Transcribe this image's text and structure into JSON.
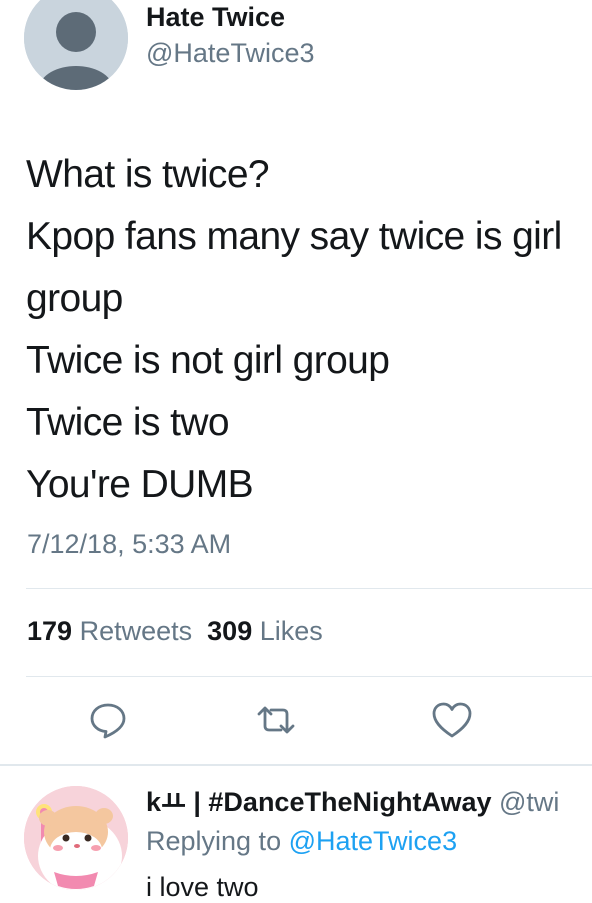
{
  "tweet": {
    "display_name": "Hate Twice",
    "handle": "@HateTwice3",
    "lines": [
      "What is twice?",
      "Kpop fans many say twice is girl",
      "group",
      "Twice is not girl group",
      "Twice is two",
      "You're DUMB"
    ],
    "timestamp": "7/12/18, 5:33 AM",
    "stats": {
      "retweets_count": "179",
      "retweets_label": "Retweets",
      "likes_count": "309",
      "likes_label": "Likes"
    },
    "actions": {
      "reply_icon": "speech-bubble-icon",
      "retweet_icon": "retweet-arrows-icon",
      "like_icon": "heart-icon"
    }
  },
  "reply": {
    "display_name": "kㅛ | #DanceTheNightAway",
    "handle": "@twi",
    "replying_prefix": "Replying to",
    "replying_handle": "@HateTwice3",
    "text": "i love two"
  },
  "colors": {
    "primary_text": "#14171a",
    "secondary_text": "#657786",
    "link": "#1da1f2",
    "divider": "#e1e8ed",
    "icon": "#657786"
  }
}
